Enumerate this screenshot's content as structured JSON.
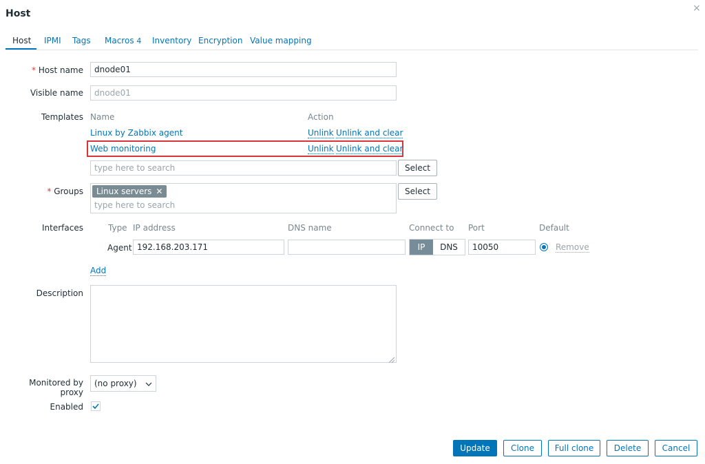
{
  "dialog": {
    "title": "Host",
    "close_icon": "close-icon"
  },
  "tabs": [
    {
      "label": "Host"
    },
    {
      "label": "IPMI"
    },
    {
      "label": "Tags"
    },
    {
      "label": "Macros",
      "count": "4"
    },
    {
      "label": "Inventory"
    },
    {
      "label": "Encryption"
    },
    {
      "label": "Value mapping"
    }
  ],
  "form": {
    "host_name": {
      "label": "Host name",
      "required_mark": "*",
      "value": "dnode01"
    },
    "visible_name": {
      "label": "Visible name",
      "placeholder": "dnode01"
    },
    "templates": {
      "label": "Templates",
      "col_name": "Name",
      "col_action": "Action",
      "rows": [
        {
          "name": "Linux by Zabbix agent",
          "unlink": "Unlink",
          "unlink_clear": "Unlink and clear"
        },
        {
          "name": "Web monitoring",
          "unlink": "Unlink",
          "unlink_clear": "Unlink and clear"
        }
      ],
      "search_placeholder": "type here to search",
      "select_label": "Select"
    },
    "groups": {
      "label": "Groups",
      "required_mark": "*",
      "tags": [
        "Linux servers"
      ],
      "search_placeholder": "type here to search",
      "select_label": "Select"
    },
    "interfaces": {
      "label": "Interfaces",
      "headers": {
        "type": "Type",
        "ip": "IP address",
        "dns": "DNS name",
        "connect": "Connect to",
        "port": "Port",
        "default": "Default"
      },
      "rows": [
        {
          "type": "Agent",
          "ip": "192.168.203.171",
          "dns": "",
          "connect_ip": "IP",
          "connect_dns": "DNS",
          "connect_selected": "IP",
          "port": "10050",
          "remove": "Remove"
        }
      ],
      "add_label": "Add"
    },
    "description": {
      "label": "Description",
      "value": ""
    },
    "proxy": {
      "label": "Monitored by proxy",
      "value": "(no proxy)"
    },
    "enabled": {
      "label": "Enabled",
      "checked": true
    }
  },
  "footer": {
    "update": "Update",
    "clone": "Clone",
    "full_clone": "Full clone",
    "delete": "Delete",
    "cancel": "Cancel"
  },
  "colors": {
    "accent": "#0275b8",
    "highlight": "#d9343c",
    "required": "#e33734"
  }
}
